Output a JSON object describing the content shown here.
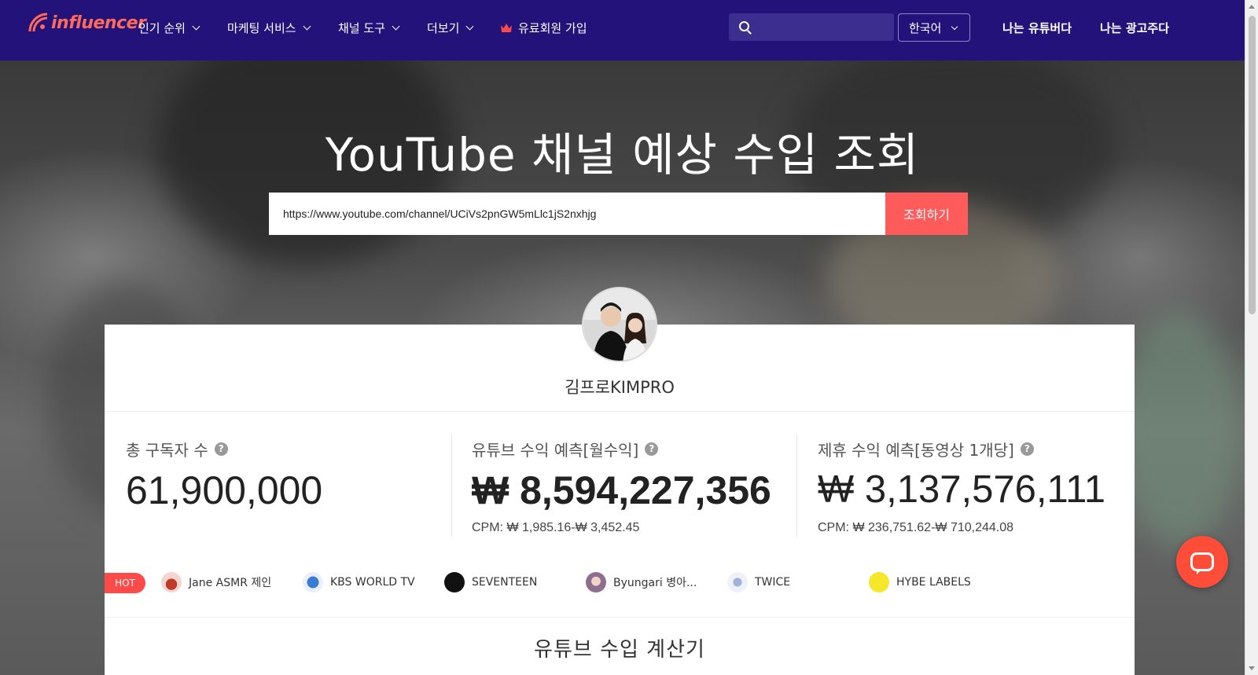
{
  "nav": {
    "logo_text": "influencer",
    "items": [
      {
        "label": "인기 순위"
      },
      {
        "label": "마케팅 서비스"
      },
      {
        "label": "채널 도구"
      },
      {
        "label": "더보기"
      }
    ],
    "premium_label": "유료회원 가입",
    "search_placeholder": "",
    "language": "한국어",
    "link_youtuber": "나는 유튜버다",
    "link_advertiser": "나는 광고주다"
  },
  "hero": {
    "title": "YouTube 채널 예상 수입 조회",
    "query_value": "https://www.youtube.com/channel/UCiVs2pnGW5mLlc1jS2nxhjg",
    "query_button": "조회하기"
  },
  "channel": {
    "name": "김프로KIMPRO"
  },
  "stats": [
    {
      "label": "총 구독자 수",
      "help": "?",
      "value": "61,900,000",
      "cpm": ""
    },
    {
      "label": "유튜브 수익 예측[월수익]",
      "help": "?",
      "value": "₩ 8,594,227,356",
      "cpm": "CPM: ₩ 1,985.16-₩ 3,452.45"
    },
    {
      "label": "제휴 수익 예측[동영상 1개당]",
      "help": "?",
      "value": "₩ 3,137,576,111",
      "cpm": "CPM: ₩ 236,751.62-₩ 710,244.08"
    }
  ],
  "hot": {
    "badge": "HOT",
    "items": [
      {
        "name": "Jane ASMR 제인",
        "color": "#c0392b"
      },
      {
        "name": "KBS WORLD TV",
        "color": "#3a7bd5"
      },
      {
        "name": "SEVENTEEN",
        "color": "#111111"
      },
      {
        "name": "Byungari 병아...",
        "color": "#8e6e8e"
      },
      {
        "name": "TWICE",
        "color": "#cfd8e8"
      },
      {
        "name": "HYBE LABELS",
        "color": "#f5e72a"
      }
    ]
  },
  "calculator": {
    "title": "유튜브 수입 계산기"
  },
  "colors": {
    "navbar": "#22127a",
    "accent": "#ff5b5b"
  }
}
